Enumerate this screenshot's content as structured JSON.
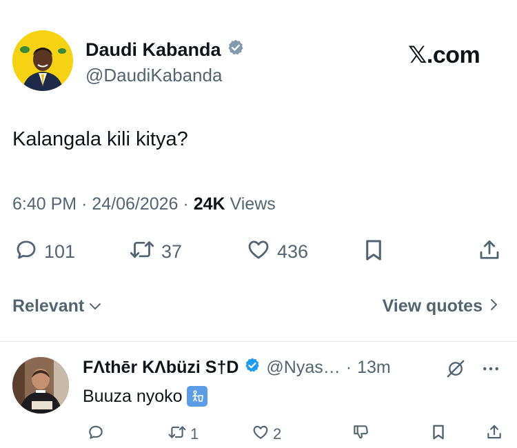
{
  "tweet": {
    "author_name": "Daudi Kabanda",
    "verified": true,
    "handle": "@DaudiKabanda",
    "brand": "𝕏.com",
    "text": "Kalangala kili kitya?",
    "time": "6:40 PM",
    "date": "24/06/2026",
    "views_count": "24K",
    "views_label": "Views",
    "stats": {
      "replies": "101",
      "reposts": "37",
      "likes": "436"
    }
  },
  "controls": {
    "sort_label": "Relevant",
    "view_quotes_label": "View quotes"
  },
  "reply": {
    "author_name": "FΛthēr KΛbüzi S†D",
    "verified": true,
    "handle": "@Nyas…",
    "separator": "·",
    "time": "13m",
    "text": "Buuza nyoko",
    "emoji": "trash-can-emoji",
    "stats": {
      "reposts": "1",
      "likes": "2"
    }
  },
  "colors": {
    "text": "#0f1419",
    "muted": "#536471",
    "verified_gray": "#829aab",
    "verified_blue": "#1d9bf0",
    "divider": "#e6e9ec",
    "avatar_bg": "#f5d313"
  },
  "icons": [
    "verified-badge-icon",
    "reply-icon",
    "retweet-icon",
    "like-icon",
    "bookmark-icon",
    "share-icon",
    "chevron-down-icon",
    "chevron-right-icon",
    "grok-icon",
    "more-icon",
    "dislike-icon"
  ]
}
